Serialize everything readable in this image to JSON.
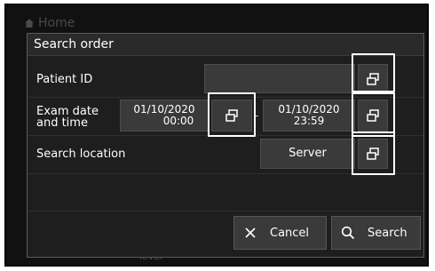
{
  "background": {
    "home_label": "Home",
    "lever_label": "lever"
  },
  "dialog": {
    "title": "Search order",
    "patient_id": {
      "label": "Patient ID",
      "value": ""
    },
    "exam_date": {
      "label_line1": "Exam date",
      "label_line2": "and time",
      "start_date": "01/10/2020",
      "start_time": "00:00",
      "end_date": "01/10/2020",
      "end_time": "23:59",
      "separator": "-"
    },
    "search_location": {
      "label": "Search location",
      "value": "Server"
    },
    "buttons": {
      "cancel": "Cancel",
      "search": "Search"
    }
  },
  "icons": {
    "picker": "window-select-icon",
    "cancel": "close-icon",
    "search": "search-icon",
    "home": "home-icon"
  },
  "colors": {
    "dialog_bg": "#1e1e1e",
    "field_bg": "#3a3a3a",
    "highlight": "#ffffff"
  }
}
